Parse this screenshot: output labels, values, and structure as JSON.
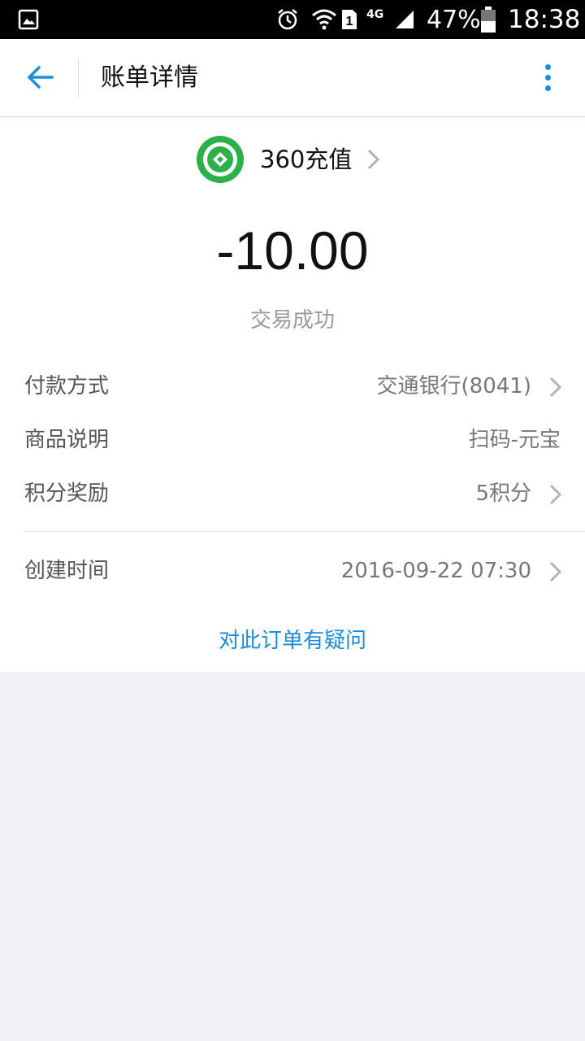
{
  "status_bar": {
    "icons": [
      "gallery-icon",
      "alarm-icon",
      "wifi-icon",
      "sim-1-icon",
      "network-4g-icon",
      "signal-icon",
      "battery-icon"
    ],
    "network": "4G",
    "sim": "1",
    "battery": "47%",
    "time": "18:38"
  },
  "header": {
    "title": "账单详情",
    "back_icon": "back-arrow-icon",
    "more_icon": "more-vertical-icon"
  },
  "merchant": {
    "name": "360充值",
    "logo_icon": "merchant-logo-icon"
  },
  "amount": "-10.00",
  "status": "交易成功",
  "details": {
    "payment_method": {
      "label": "付款方式",
      "value": "交通银行(8041)"
    },
    "description": {
      "label": "商品说明",
      "value": "扫码-元宝"
    },
    "points": {
      "label": "积分奖励",
      "value": "5积分"
    },
    "created_time": {
      "label": "创建时间",
      "value": "2016-09-22 07:30"
    }
  },
  "question_link": "对此订单有疑问",
  "colors": {
    "accent": "#1a8de0",
    "logo_green": "#2bb14a",
    "background": "#f2f2f6"
  }
}
